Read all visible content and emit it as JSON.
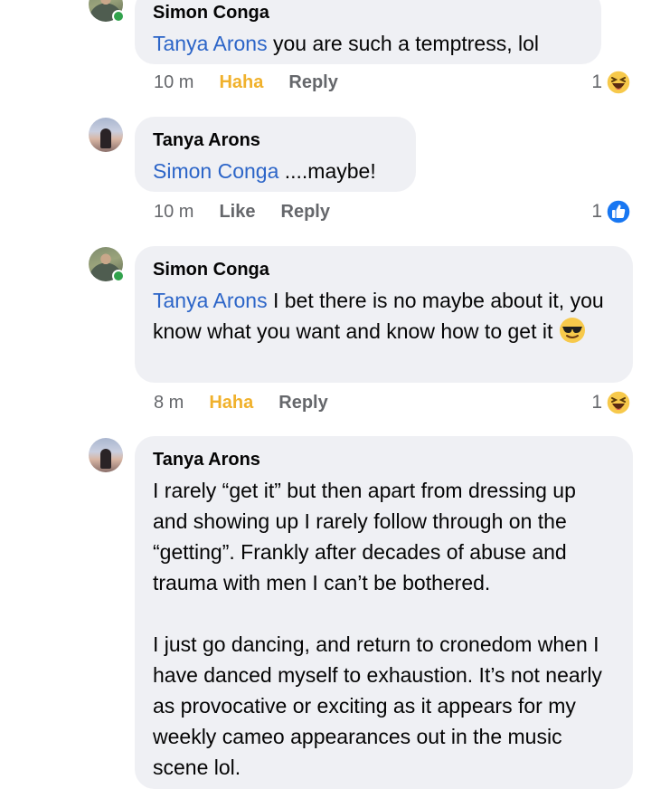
{
  "comments": [
    {
      "author": "Simon Conga",
      "mention": "Tanya Arons",
      "text": " you are such a temptress, lol",
      "time": "10 m",
      "reaction_label": "Haha",
      "reply_label": "Reply",
      "reaction_count": "1",
      "reaction_icon": "haha-emoji-icon"
    },
    {
      "author": "Tanya Arons",
      "mention": "Simon Conga",
      "text": " ....maybe!",
      "time": "10 m",
      "reaction_label": "Like",
      "reply_label": "Reply",
      "reaction_count": "1",
      "reaction_icon": "like-thumb-icon"
    },
    {
      "author": "Simon Conga",
      "mention": "Tanya Arons",
      "text": " I bet there is no maybe about it, you know what you want and know how to get it",
      "emoji": "sunglasses-emoji-icon",
      "time": "8 m",
      "reaction_label": "Haha",
      "reply_label": "Reply",
      "reaction_count": "1",
      "reaction_icon": "haha-emoji-icon"
    },
    {
      "author": "Tanya Arons",
      "paragraphs": [
        "I rarely “get it” but then apart from dressing up and showing up I rarely follow through on the “getting”. Frankly after decades of abuse and trauma with men I can’t be bothered.",
        "I just go dancing, and return to cronedom when I have danced myself to exhaustion. It’s not nearly as provocative or exciting as it appears for my weekly cameo appearances out in the music scene lol."
      ]
    }
  ],
  "colors": {
    "bubble": "#eff0f4",
    "mention": "#2c65c8",
    "haha": "#f0b12c",
    "meta": "#65676b",
    "online": "#31a24c",
    "like_blue": "#1877f2"
  }
}
